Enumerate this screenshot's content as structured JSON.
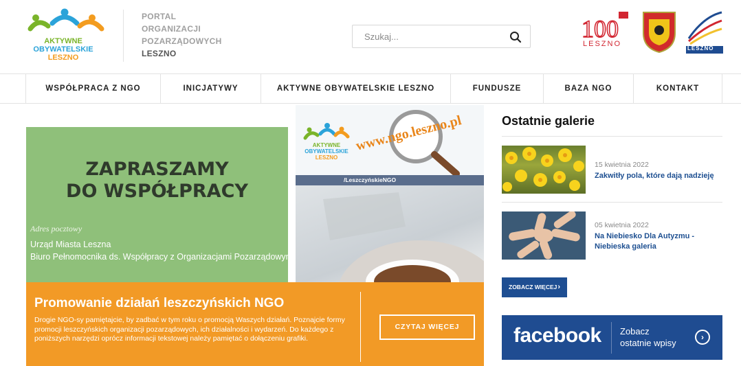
{
  "header": {
    "logo": {
      "line1": "AKTYWNE",
      "line2": "OBYWATELSKIE",
      "line3": "LESZNO"
    },
    "portal": {
      "line1": "PORTAL",
      "line2": "ORGANIZACJI",
      "line3": "POZARZĄDOWYCH",
      "line4": "LESZNO"
    },
    "search": {
      "placeholder": "Szukaj..."
    },
    "partners": {
      "p100_text": "LESZNO",
      "plesz_text": "LESZNO"
    }
  },
  "nav": {
    "items": [
      {
        "label": "WSPÓŁPRACA Z NGO"
      },
      {
        "label": "INICJATYWY"
      },
      {
        "label": "AKTYWNE OBYWATELSKIE LESZNO"
      },
      {
        "label": "FUNDUSZE"
      },
      {
        "label": "BAZA NGO"
      },
      {
        "label": "KONTAKT"
      }
    ]
  },
  "hero": {
    "green": {
      "heading_line1": "ZAPRASZAMY",
      "heading_line2": "DO WSPÓŁPRACY",
      "address_label": "Adres pocztowy",
      "address_line1": "Urząd Miasta Leszna",
      "address_line2": "Biuro Pełnomocnika ds. Współpracy z Organizacjami Pozarządowymi"
    },
    "photo": {
      "logo_line1": "AKTYWNE",
      "logo_line2": "OBYWATELSKIE",
      "logo_line3": "LESZNO",
      "url_text": "www.ngo.leszno.pl",
      "social_handle": "/LeszczyńskieNGO"
    },
    "promo": {
      "title": "Promowanie działań leszczyńskich NGO",
      "body": "Drogie NGO-sy pamiętajcie, by zadbać w tym roku o promocją Waszych działań. Poznajcie formy promocji leszczyńskich organizacji pozarządowych, ich działalności i wydarzeń. Do każdego z poniższych narzędzi oprócz informacji tekstowej należy pamiętać o dołączeniu grafiki.",
      "button": "CZYTAJ WIĘCEJ"
    }
  },
  "sidebar": {
    "title": "Ostatnie galerie",
    "galleries": [
      {
        "date": "15 kwietnia 2022",
        "title": "Zakwitły pola, które dają nadzieję"
      },
      {
        "date": "05 kwietnia 2022",
        "title": "Na Niebiesko Dla Autyzmu - Niebieska galeria"
      }
    ],
    "more_button": "ZOBACZ WIĘCEJ",
    "facebook": {
      "logo": "facebook",
      "line1": "Zobacz",
      "line2": "ostatnie wpisy"
    }
  },
  "colors": {
    "accent_blue": "#1e4e92",
    "orange": "#f29a26",
    "green_panel": "#8fc07a"
  }
}
